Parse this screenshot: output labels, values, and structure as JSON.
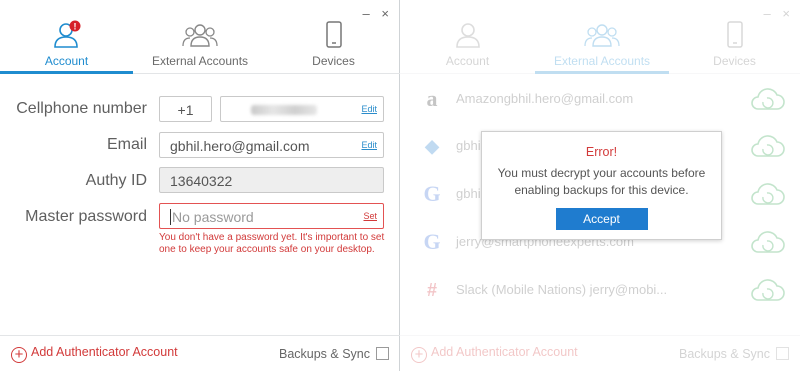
{
  "left": {
    "window_controls": [
      "–",
      "×"
    ],
    "tabs": [
      {
        "label": "Account",
        "active": true,
        "badge": "!"
      },
      {
        "label": "External Accounts",
        "active": false
      },
      {
        "label": "Devices",
        "active": false
      }
    ],
    "form": {
      "cellphone": {
        "label": "Cellphone number",
        "country_code": "+1",
        "action": "Edit"
      },
      "email": {
        "label": "Email",
        "value": "gbhil.hero@gmail.com",
        "action": "Edit"
      },
      "authy_id": {
        "label": "Authy ID",
        "value": "13640322"
      },
      "master_password": {
        "label": "Master password",
        "placeholder": "No password",
        "action": "Set",
        "error": "You don't have a password yet. It's important to set one to keep your accounts safe on your desktop."
      }
    },
    "bottom": {
      "add_label": "Add Authenticator Account",
      "backup_label": "Backups & Sync"
    }
  },
  "right": {
    "window_controls": [
      "–",
      "×"
    ],
    "tabs": [
      {
        "label": "Account",
        "active": false
      },
      {
        "label": "External Accounts",
        "active": true
      },
      {
        "label": "Devices",
        "active": false
      }
    ],
    "accounts": [
      {
        "name": "Amazongbhil.hero@gmail.com",
        "icon": "amazon-icon"
      },
      {
        "name": "gbhil",
        "icon": "dropbox-icon"
      },
      {
        "name": "gbhi",
        "icon": "google-icon"
      },
      {
        "name": "jerry@smartphoneexperts.com",
        "icon": "google-icon"
      },
      {
        "name": "Slack (Mobile Nations) jerry@mobi...",
        "icon": "slack-icon"
      }
    ],
    "dialog": {
      "title": "Error!",
      "message": "You must decrypt your accounts before enabling backups for this device.",
      "button": "Accept"
    },
    "bottom": {
      "add_label": "Add Authenticator Account",
      "backup_label": "Backups & Sync"
    }
  },
  "colors": {
    "accent_blue": "#1f8ccf",
    "error_red": "#d23a3a",
    "dialog_button": "#1f7ccf"
  }
}
